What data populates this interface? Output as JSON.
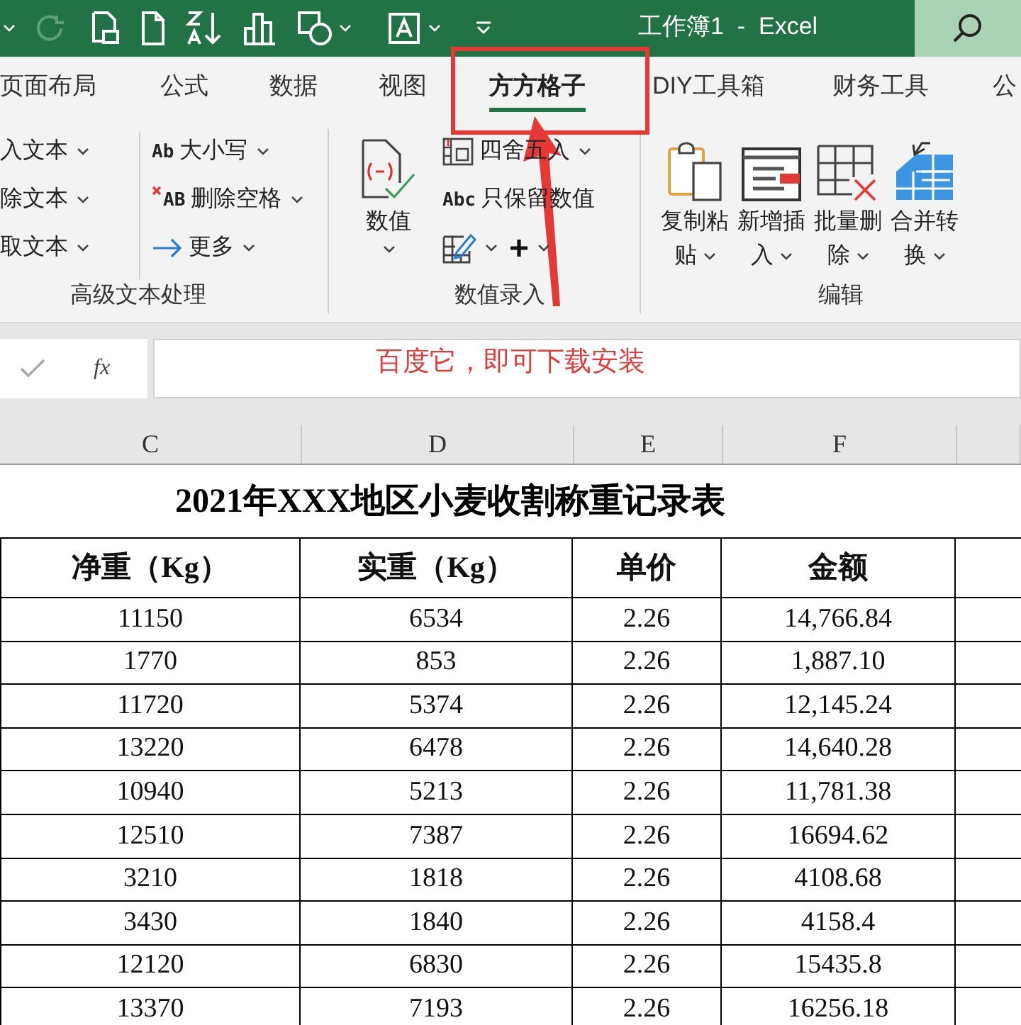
{
  "window": {
    "title": "工作簿1  -  Excel"
  },
  "tabs": [
    {
      "label": "页面布局",
      "selected": false
    },
    {
      "label": "公式",
      "selected": false
    },
    {
      "label": "数据",
      "selected": false
    },
    {
      "label": "视图",
      "selected": false
    },
    {
      "label": "方方格子",
      "selected": true
    },
    {
      "label": "DIY工具箱",
      "selected": false
    },
    {
      "label": "财务工具",
      "selected": false
    },
    {
      "label": "公",
      "selected": false
    }
  ],
  "ribbon": {
    "groups": [
      {
        "label": "高级文本处理",
        "columns": [
          {
            "kind": "stack",
            "rows": [
              [
                {
                  "label": "入文本",
                  "icon": false,
                  "dropdown": true
                }
              ],
              [
                {
                  "label": "除文本",
                  "icon": false,
                  "dropdown": true
                }
              ],
              [
                {
                  "label": "取文本",
                  "icon": false,
                  "dropdown": true
                }
              ]
            ]
          },
          {
            "kind": "stack",
            "rows": [
              [
                {
                  "label": "大小写",
                  "icon_text": "Ab",
                  "icon": false,
                  "dropdown": true
                }
              ],
              [
                {
                  "label": "删除空格",
                  "icon_text": "AB",
                  "icon": true,
                  "dropdown": true
                }
              ],
              [
                {
                  "label": "更多",
                  "icon": true,
                  "dropdown": true
                }
              ]
            ]
          }
        ]
      },
      {
        "label": "数值录入",
        "columns": [
          {
            "kind": "large",
            "label": "数值",
            "icon": true,
            "dropdown": true
          },
          {
            "kind": "stack",
            "rows": [
              [
                {
                  "label": "四舍五入",
                  "icon": true,
                  "dropdown": true
                }
              ],
              [
                {
                  "label": "只保留数值",
                  "icon_text": "Abc",
                  "icon": false,
                  "dropdown": false
                }
              ],
              [
                {
                  "icon": true,
                  "dropdown": true
                },
                {
                  "icon": true,
                  "dropdown": true
                }
              ]
            ]
          }
        ]
      },
      {
        "label": "编辑",
        "columns": [
          {
            "kind": "large",
            "label": "复制粘贴",
            "icon": true,
            "dropdown": true
          },
          {
            "kind": "large",
            "label": "新增插入",
            "icon": true,
            "dropdown": true
          },
          {
            "kind": "large",
            "label": "批量删除",
            "icon": true,
            "dropdown": true
          },
          {
            "kind": "large",
            "label": "合并转换",
            "icon": true,
            "dropdown": true
          }
        ]
      }
    ]
  },
  "formula_bar": {
    "function_label": "fx"
  },
  "annotation": {
    "note": "百度它，即可下载安装"
  },
  "sheet": {
    "column_headers": [
      "C",
      "D",
      "E",
      "F"
    ],
    "title": "2021年XXX地区小麦收割称重记录表",
    "headers": [
      "净重（Kg）",
      "实重（Kg）",
      "单价",
      "金额"
    ],
    "rows": [
      [
        "11150",
        "6534",
        "2.26",
        "14,766.84"
      ],
      [
        "1770",
        "853",
        "2.26",
        "1,887.10"
      ],
      [
        "11720",
        "5374",
        "2.26",
        "12,145.24"
      ],
      [
        "13220",
        "6478",
        "2.26",
        "14,640.28"
      ],
      [
        "10940",
        "5213",
        "2.26",
        "11,781.38"
      ],
      [
        "12510",
        "7387",
        "2.26",
        "16694.62"
      ],
      [
        "3210",
        "1818",
        "2.26",
        "4108.68"
      ],
      [
        "3430",
        "1840",
        "2.26",
        "4158.4"
      ],
      [
        "12120",
        "6830",
        "2.26",
        "15435.8"
      ],
      [
        "13370",
        "7193",
        "2.26",
        "16256.18"
      ]
    ]
  }
}
